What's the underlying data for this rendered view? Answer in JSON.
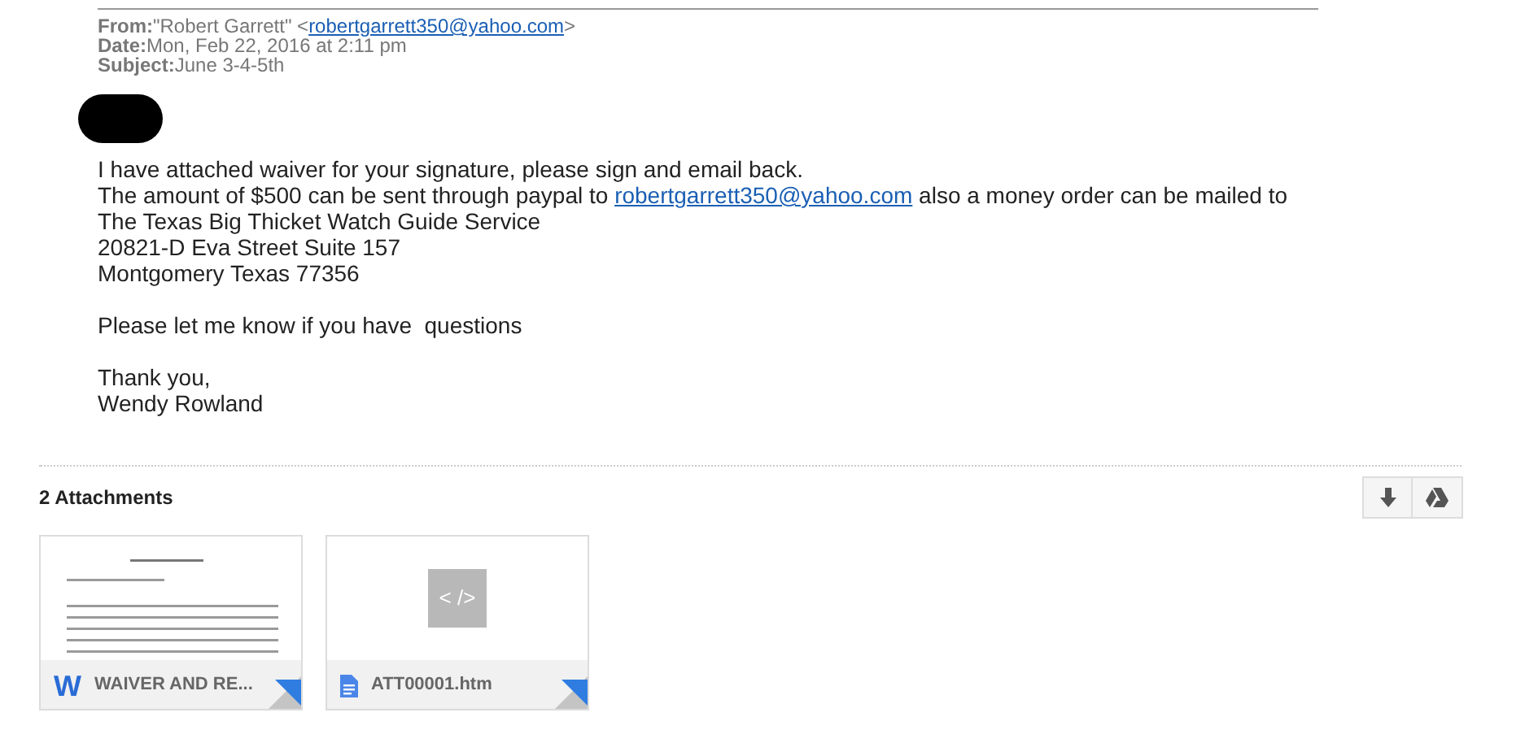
{
  "header": {
    "from_label": "From:",
    "from_name": "\"Robert Garrett\" <",
    "from_email": "robertgarrett350@yahoo.com",
    "from_end": ">",
    "date_label": "Date:",
    "date": "Mon, Feb 22, 2016 at 2:11 pm",
    "subject_label": "Subject:",
    "subject": "June 3-4-5th"
  },
  "body": {
    "paragraphs": [
      [
        {
          "parts": [
            {
              "text": "I have attached waiver for your signature, please sign and email back."
            }
          ]
        },
        {
          "parts": [
            {
              "text": "The amount of $500 can be sent through paypal to "
            },
            {
              "text": "robertgarrett350@yahoo.com",
              "kind": "link"
            },
            {
              "text": " also a money order can be mailed to"
            }
          ]
        },
        {
          "parts": [
            {
              "text": "The Texas Big Thicket Watch Guide Service"
            }
          ]
        },
        {
          "parts": [
            {
              "text": "20821-D Eva Street Suite 157"
            }
          ]
        },
        {
          "parts": [
            {
              "text": "Montgomery Texas 77356"
            }
          ]
        }
      ],
      [
        {
          "parts": [
            {
              "text": "Please let me know if you have  questions"
            }
          ]
        }
      ],
      [
        {
          "parts": [
            {
              "text": "Thank you,"
            }
          ]
        },
        {
          "parts": [
            {
              "text": "Wendy Rowland"
            }
          ]
        }
      ]
    ]
  },
  "attachments": {
    "title": "2 Attachments",
    "items": [
      {
        "kind": "word",
        "icon_text": "W",
        "name": "WAIVER AND RE..."
      },
      {
        "kind": "htm",
        "preview_glyph": "< />",
        "name": "ATT00001.htm"
      }
    ]
  }
}
